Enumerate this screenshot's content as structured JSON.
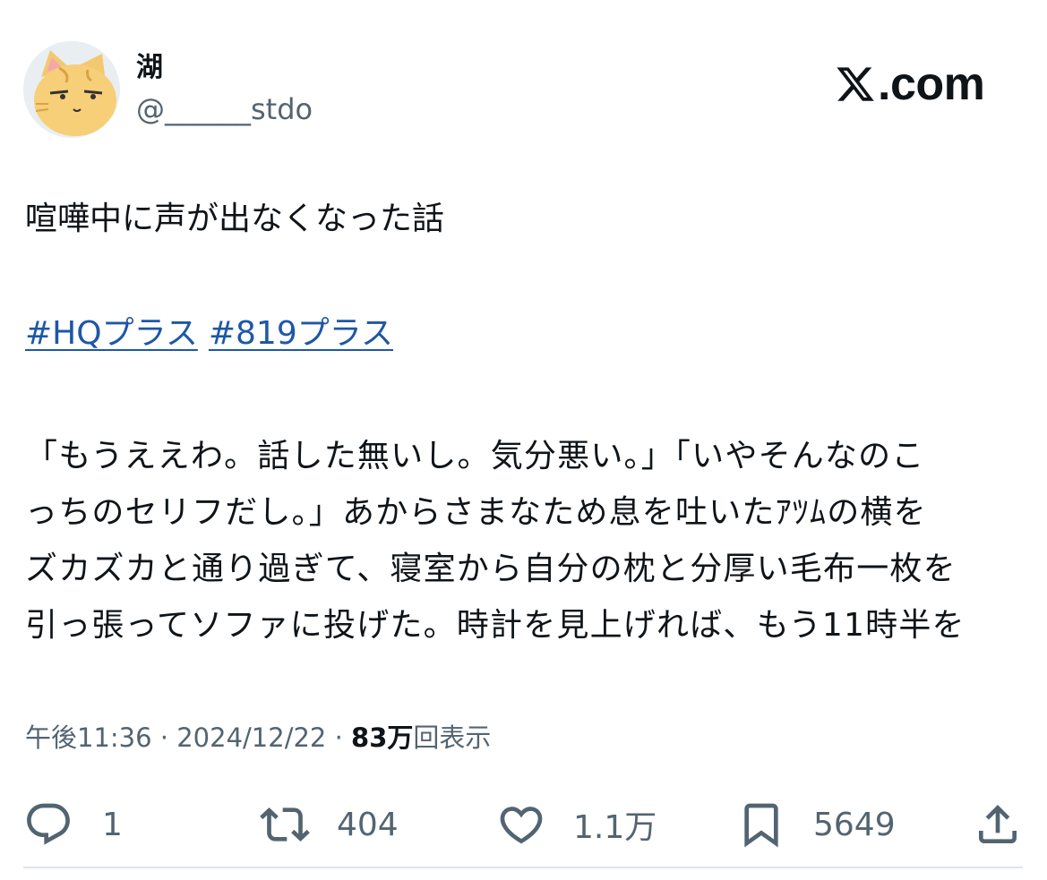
{
  "header": {
    "display_name": "湖",
    "handle": "@______stdo",
    "logo_text": ".com",
    "logo_icon": "x-logo-icon",
    "avatar_icon": "cat-avatar-icon"
  },
  "tweet": {
    "title": "喧嘩中に声が出なくなった話",
    "hashtags": [
      "#HQプラス",
      "#819プラス"
    ],
    "body_lines": [
      "「もうええわ。話した無いし。気分悪い。」「いやそんなのこ",
      "っちのセリフだし。」あからさまなため息を吐いたｱﾂﾑの横を",
      "ズカズカと通り過ぎて、寝室から自分の枕と分厚い毛布一枚を",
      "引っ張ってソファに投げた。時計を見上げれば、もう11時半を"
    ]
  },
  "meta": {
    "time": "午後11:36",
    "separator": " · ",
    "date": "2024/12/22",
    "views_number": "83万",
    "views_label": "回表示"
  },
  "actions": {
    "reply_count": "1",
    "retweet_count": "404",
    "like_count": "1.1万",
    "bookmark_count": "5649"
  },
  "colors": {
    "text": "#0f1419",
    "secondary": "#536471",
    "link": "#1d57a8",
    "divider": "#dfe5ea"
  }
}
